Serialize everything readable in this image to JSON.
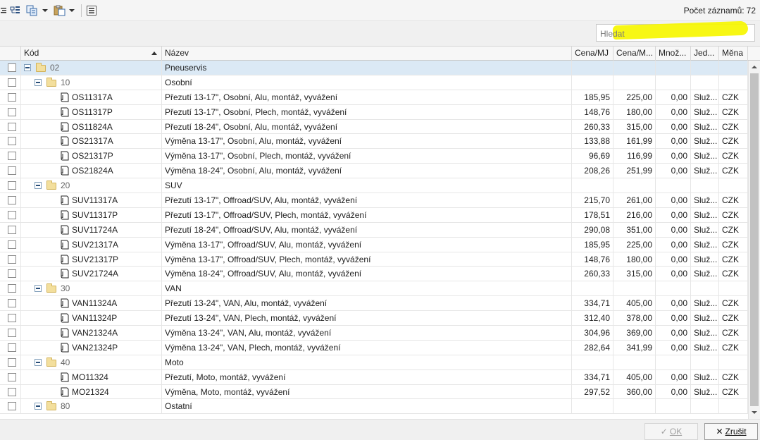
{
  "toolbar": {
    "record_count_label": "Počet záznamů:",
    "record_count": "72"
  },
  "search": {
    "placeholder": "Hledat",
    "value": ""
  },
  "columns": [
    "Kód",
    "Název",
    "Cena/MJ",
    "Cena/M...",
    "Množ...",
    "Jed...",
    "Měna"
  ],
  "rows": [
    {
      "level": 0,
      "type": "folder",
      "code": "02",
      "name": "Pneuservis",
      "selected": true
    },
    {
      "level": 1,
      "type": "folder",
      "code": "10",
      "name": "Osobní"
    },
    {
      "level": 2,
      "type": "item",
      "code": "OS11317A",
      "name": "Přezutí 13-17\", Osobní, Alu, montáž, vyvážení",
      "price": "185,95",
      "price_vat": "225,00",
      "qty": "0,00",
      "unit": "Služ...",
      "currency": "CZK"
    },
    {
      "level": 2,
      "type": "item",
      "code": "OS11317P",
      "name": "Přezutí 13-17\", Osobní, Plech, montáž, vyvážení",
      "price": "148,76",
      "price_vat": "180,00",
      "qty": "0,00",
      "unit": "Služ...",
      "currency": "CZK"
    },
    {
      "level": 2,
      "type": "item",
      "code": "OS11824A",
      "name": "Přezutí 18-24\", Osobní, Alu, montáž, vyvážení",
      "price": "260,33",
      "price_vat": "315,00",
      "qty": "0,00",
      "unit": "Služ...",
      "currency": "CZK"
    },
    {
      "level": 2,
      "type": "item",
      "code": "OS21317A",
      "name": "Výměna 13-17\", Osobní, Alu, montáž, vyvážení",
      "price": "133,88",
      "price_vat": "161,99",
      "qty": "0,00",
      "unit": "Služ...",
      "currency": "CZK"
    },
    {
      "level": 2,
      "type": "item",
      "code": "OS21317P",
      "name": "Výměna 13-17\", Osobní, Plech, montáž, vyvážení",
      "price": "96,69",
      "price_vat": "116,99",
      "qty": "0,00",
      "unit": "Služ...",
      "currency": "CZK"
    },
    {
      "level": 2,
      "type": "item",
      "code": "OS21824A",
      "name": "Výměna 18-24\", Osobní, Alu, montáž, vyvážení",
      "price": "208,26",
      "price_vat": "251,99",
      "qty": "0,00",
      "unit": "Služ...",
      "currency": "CZK"
    },
    {
      "level": 1,
      "type": "folder",
      "code": "20",
      "name": "SUV"
    },
    {
      "level": 2,
      "type": "item",
      "code": "SUV11317A",
      "name": "Přezutí 13-17\", Offroad/SUV, Alu, montáž, vyvážení",
      "price": "215,70",
      "price_vat": "261,00",
      "qty": "0,00",
      "unit": "Služ...",
      "currency": "CZK"
    },
    {
      "level": 2,
      "type": "item",
      "code": "SUV11317P",
      "name": "Přezutí 13-17\", Offroad/SUV, Plech, montáž, vyvážení",
      "price": "178,51",
      "price_vat": "216,00",
      "qty": "0,00",
      "unit": "Služ...",
      "currency": "CZK"
    },
    {
      "level": 2,
      "type": "item",
      "code": "SUV11724A",
      "name": "Přezutí 18-24\", Offroad/SUV, Alu, montáž, vyvážení",
      "price": "290,08",
      "price_vat": "351,00",
      "qty": "0,00",
      "unit": "Služ...",
      "currency": "CZK"
    },
    {
      "level": 2,
      "type": "item",
      "code": "SUV21317A",
      "name": "Výměna 13-17\", Offroad/SUV, Alu, montáž, vyvážení",
      "price": "185,95",
      "price_vat": "225,00",
      "qty": "0,00",
      "unit": "Služ...",
      "currency": "CZK"
    },
    {
      "level": 2,
      "type": "item",
      "code": "SUV21317P",
      "name": "Výměna 13-17\", Offroad/SUV, Plech, montáž, vyvážení",
      "price": "148,76",
      "price_vat": "180,00",
      "qty": "0,00",
      "unit": "Služ...",
      "currency": "CZK"
    },
    {
      "level": 2,
      "type": "item",
      "code": "SUV21724A",
      "name": "Výměna 18-24\", Offroad/SUV, Alu, montáž, vyvážení",
      "price": "260,33",
      "price_vat": "315,00",
      "qty": "0,00",
      "unit": "Služ...",
      "currency": "CZK"
    },
    {
      "level": 1,
      "type": "folder",
      "code": "30",
      "name": "VAN"
    },
    {
      "level": 2,
      "type": "item",
      "code": "VAN11324A",
      "name": "Přezutí 13-24\", VAN, Alu, montáž, vyvážení",
      "price": "334,71",
      "price_vat": "405,00",
      "qty": "0,00",
      "unit": "Služ...",
      "currency": "CZK"
    },
    {
      "level": 2,
      "type": "item",
      "code": "VAN11324P",
      "name": "Přezutí 13-24\", VAN, Plech, montáž, vyvážení",
      "price": "312,40",
      "price_vat": "378,00",
      "qty": "0,00",
      "unit": "Služ...",
      "currency": "CZK"
    },
    {
      "level": 2,
      "type": "item",
      "code": "VAN21324A",
      "name": "Výměna 13-24\", VAN, Alu, montáž, vyvážení",
      "price": "304,96",
      "price_vat": "369,00",
      "qty": "0,00",
      "unit": "Služ...",
      "currency": "CZK"
    },
    {
      "level": 2,
      "type": "item",
      "code": "VAN21324P",
      "name": "Výměna 13-24\", VAN, Plech, montáž, vyvážení",
      "price": "282,64",
      "price_vat": "341,99",
      "qty": "0,00",
      "unit": "Služ...",
      "currency": "CZK"
    },
    {
      "level": 1,
      "type": "folder",
      "code": "40",
      "name": "Moto"
    },
    {
      "level": 2,
      "type": "item",
      "code": "MO11324",
      "name": "Přezutí, Moto, montáž, vyvážení",
      "price": "334,71",
      "price_vat": "405,00",
      "qty": "0,00",
      "unit": "Služ...",
      "currency": "CZK"
    },
    {
      "level": 2,
      "type": "item",
      "code": "MO21324",
      "name": "Výměna, Moto, montáž, vyvážení",
      "price": "297,52",
      "price_vat": "360,00",
      "qty": "0,00",
      "unit": "Služ...",
      "currency": "CZK"
    },
    {
      "level": 1,
      "type": "folder",
      "code": "80",
      "name": "Ostatní"
    }
  ],
  "buttons": {
    "ok_glyph": "✓",
    "ok_label": "OK",
    "cancel_glyph": "✕",
    "cancel_label": "Zrušit"
  },
  "colors": {
    "selected_row": "#dbe9f5",
    "highlight": "#f6f600"
  }
}
